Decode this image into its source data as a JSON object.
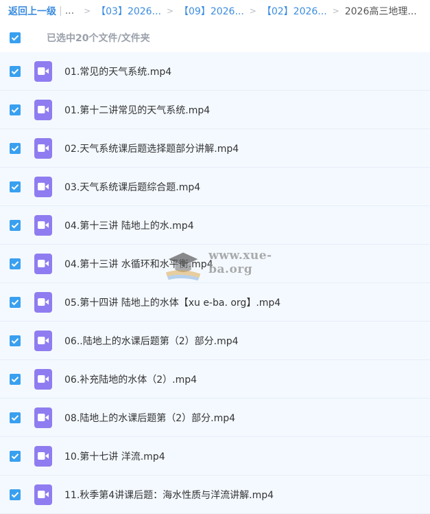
{
  "breadcrumb": {
    "back": "返回上一级",
    "pipe": "|",
    "ellipsis": "...",
    "sep": ">",
    "crumbs": [
      "【03】2026...",
      "【09】2026...",
      "【02】2026..."
    ],
    "current": "2026高三地理..."
  },
  "selection": {
    "label": "已选中20个文件/文件夹"
  },
  "files": [
    {
      "name": "01.常见的天气系统.mp4"
    },
    {
      "name": "01.第十二讲常见的天气系统.mp4"
    },
    {
      "name": "02.天气系统课后题选择题部分讲解.mp4"
    },
    {
      "name": "03.天气系统课后题综合题.mp4"
    },
    {
      "name": "04.第十三讲 陆地上的水.mp4"
    },
    {
      "name": "04.第十三讲 水循环和水平衡.mp4"
    },
    {
      "name": "05.第十四讲 陆地上的水体【xu e-ba. org】.mp4"
    },
    {
      "name": "06..陆地上的水课后题第（2）部分.mp4"
    },
    {
      "name": "06.补充陆地的水体（2）.mp4"
    },
    {
      "name": "08.陆地上的水课后题第（2）部分.mp4"
    },
    {
      "name": "10.第十七讲 洋流.mp4"
    },
    {
      "name": "11.秋季第4讲课后题：海水性质与洋流讲解.mp4"
    }
  ],
  "watermark": {
    "text": "www.xue-ba.org"
  },
  "colors": {
    "accent": "#39a0f0",
    "link": "#3b8cdf",
    "video_icon": "#8f7cf0",
    "list_bg": "#f4f9ff"
  },
  "icons": {
    "checkbox": "checkbox-checked-icon",
    "file": "video-file-icon",
    "watermark": "graduation-cap-icon"
  }
}
